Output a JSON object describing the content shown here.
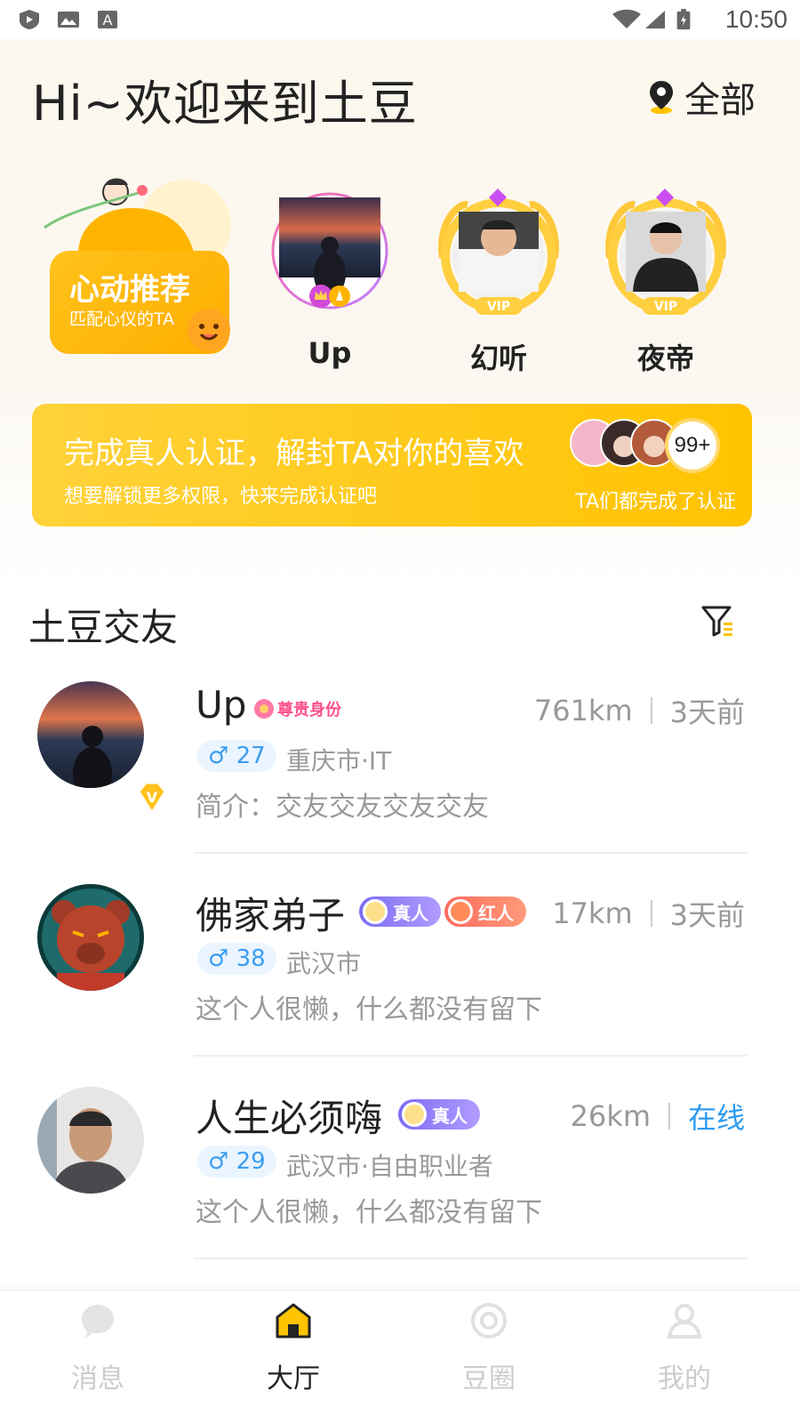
{
  "status_bar": {
    "time": "10:50"
  },
  "header": {
    "greeting": "Hi~欢迎来到土豆",
    "location": "全部"
  },
  "heart_card": {
    "title": "心动推荐",
    "subtitle": "匹配心仪的TA"
  },
  "featured": [
    {
      "name": "Up"
    },
    {
      "name": "幻听",
      "badge": "VIP"
    },
    {
      "name": "夜帝",
      "badge": "VIP"
    }
  ],
  "verify_banner": {
    "title": "完成真人认证，解封TA对你的喜欢",
    "subtitle": "想要解锁更多权限，快来完成认证吧",
    "count": "99+",
    "note": "TA们都完成了认证"
  },
  "section": {
    "title": "土豆交友"
  },
  "users": [
    {
      "name": "Up",
      "honor_badge": "尊贵身份",
      "distance": "761km",
      "time": "3天前",
      "gender_age": "♂ 27",
      "city": "重庆市·IT",
      "bio": "简介：交友交友交友交友",
      "vip_mark": "V"
    },
    {
      "name": "佛家弟子",
      "badge_real": "真人",
      "badge_red": "红人",
      "distance": "17km",
      "time": "3天前",
      "gender_age": "♂ 38",
      "city": "武汉市",
      "bio": "这个人很懒，什么都没有留下"
    },
    {
      "name": "人生必须嗨",
      "badge_real": "真人",
      "distance": "26km",
      "time": "在线",
      "gender_age": "♂ 29",
      "city": "武汉市·自由职业者",
      "bio": "这个人很懒，什么都没有留下"
    }
  ],
  "bottom_nav": {
    "items": [
      {
        "label": "消息",
        "icon": "message-icon"
      },
      {
        "label": "大厅",
        "icon": "home-icon"
      },
      {
        "label": "豆圈",
        "icon": "circle-icon"
      },
      {
        "label": "我的",
        "icon": "person-icon"
      }
    ],
    "active": "大厅"
  },
  "colors": {
    "accent_yellow": "#ffc300",
    "online_blue": "#2d9bf0",
    "gender_blue": "#3d9df0"
  }
}
